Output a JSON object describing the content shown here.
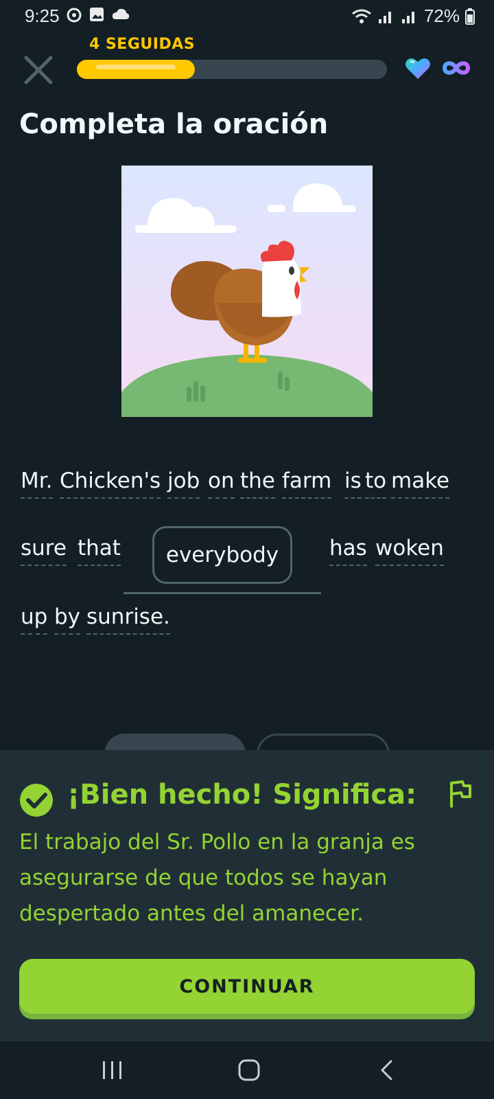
{
  "status_bar": {
    "time": "9:25",
    "battery": "72%"
  },
  "header": {
    "streak_label": "4 SEGUIDAS",
    "progress": 0.38
  },
  "exercise": {
    "title": "Completa la oración",
    "sentence_words": [
      "Mr.",
      "Chicken's",
      "job",
      "on",
      "the",
      "farm",
      "is",
      "to",
      "make",
      "sure",
      "that",
      "has",
      "woken",
      "up",
      "by",
      "sunrise."
    ],
    "selected_answer": "everybody"
  },
  "feedback": {
    "title": "¡Bien hecho! Significa:",
    "translation": "El trabajo del Sr. Pollo en la granja es asegurarse de que todos se hayan despertado antes del amanecer.",
    "continue_label": "CONTINUAR"
  },
  "colors": {
    "background": "#131f24",
    "accent_green": "#93d333",
    "streak_yellow": "#ffc800"
  },
  "icons": [
    "close-icon",
    "heart-icon",
    "infinity-icon",
    "check-icon",
    "flag-icon",
    "nav-recent-icon",
    "nav-home-icon",
    "nav-back-icon"
  ]
}
